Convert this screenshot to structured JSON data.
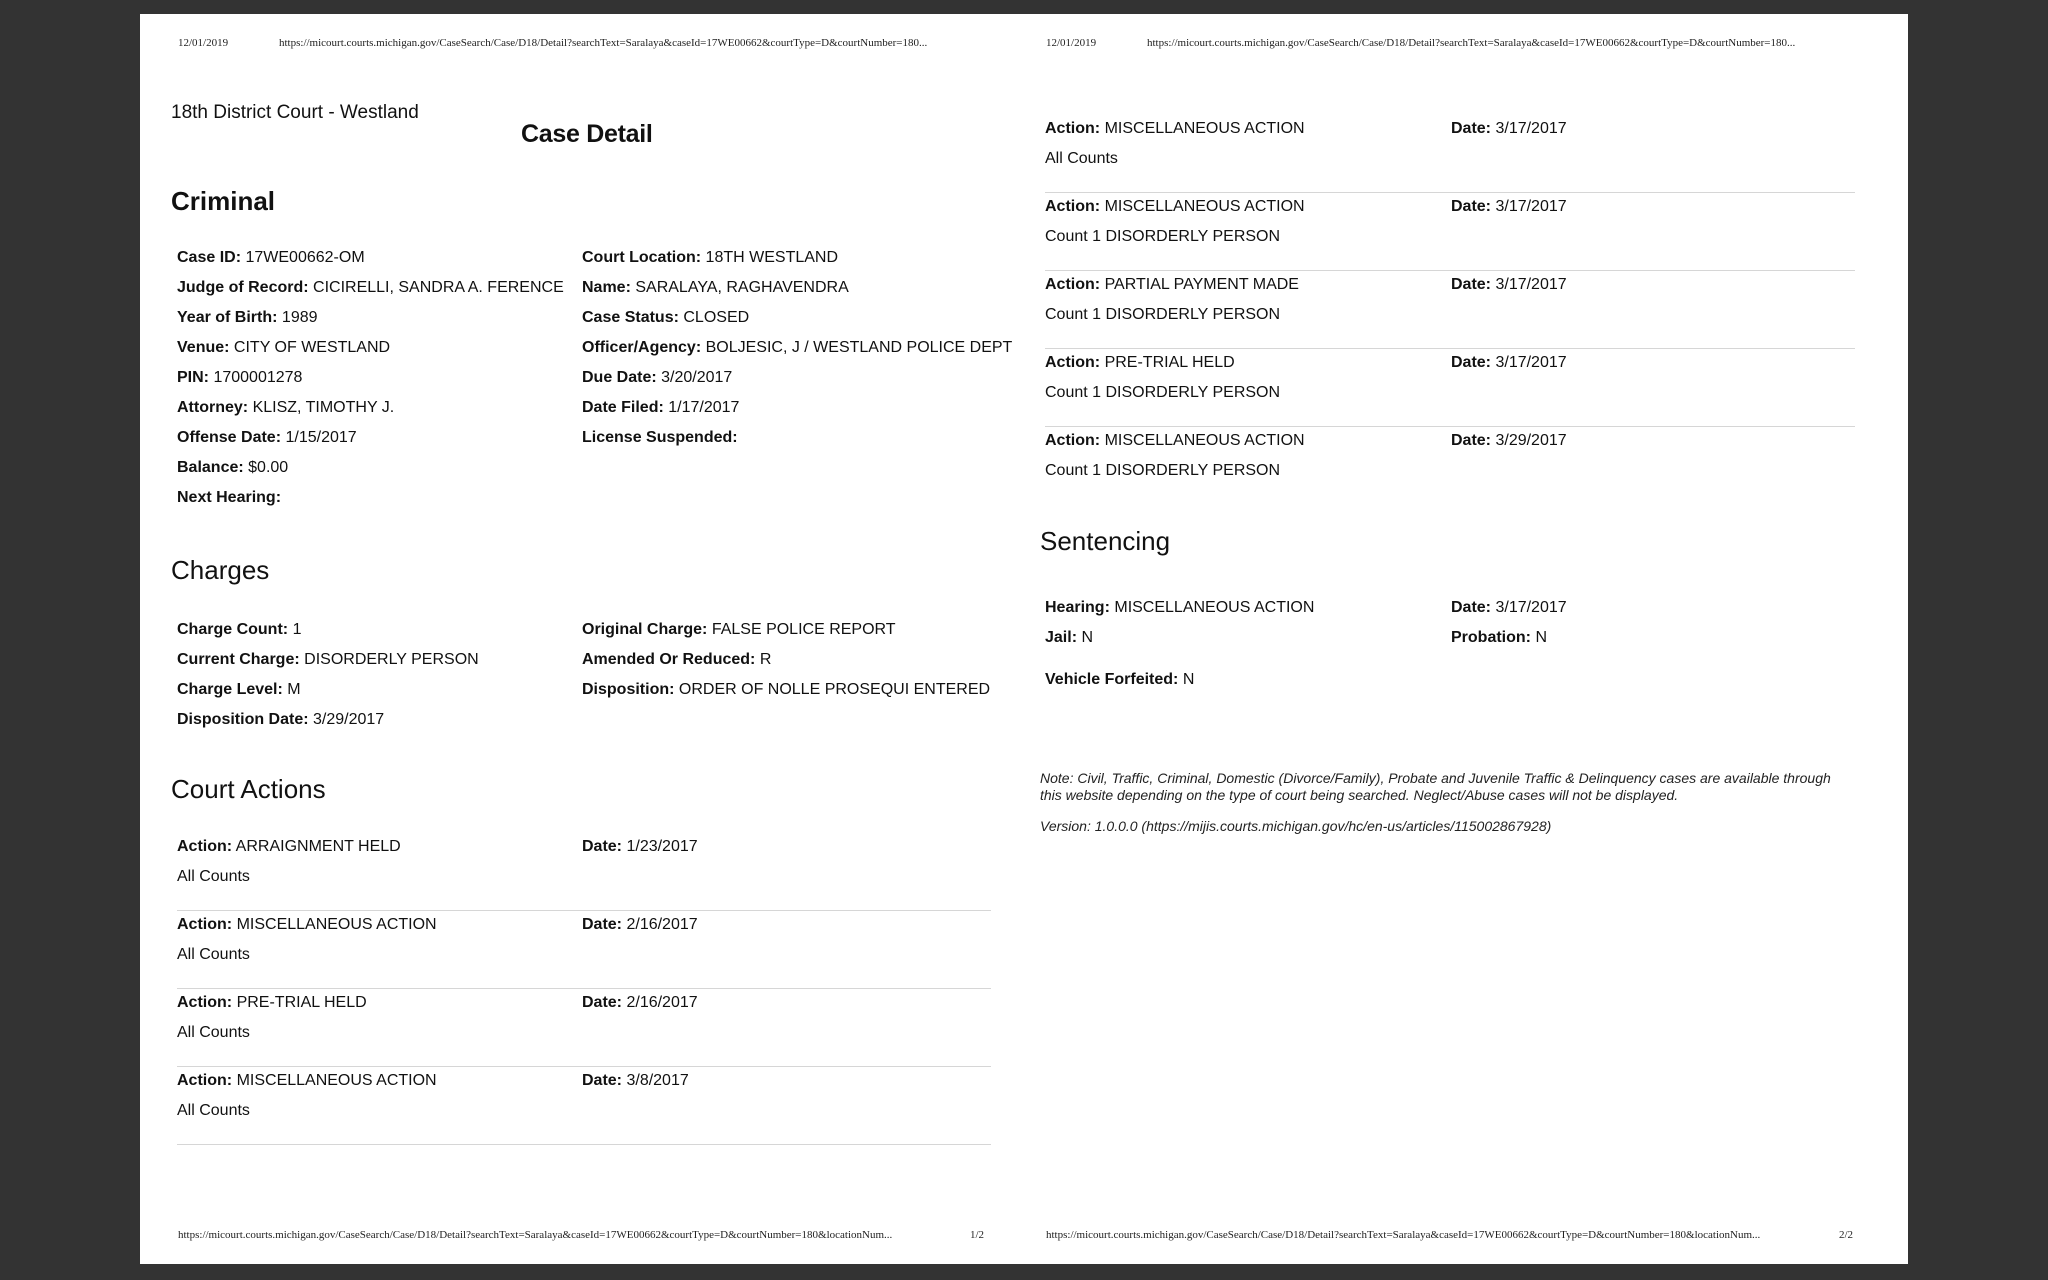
{
  "header": {
    "date": "12/01/2019",
    "url": "https://micourt.courts.michigan.gov/CaseSearch/Case/D18/Detail?searchText=Saralaya&caseId=17WE00662&courtType=D&courtNumber=180..."
  },
  "footer": {
    "url": "https://micourt.courts.michigan.gov/CaseSearch/Case/D18/Detail?searchText=Saralaya&caseId=17WE00662&courtType=D&courtNumber=180&locationNum...",
    "page1": "1/2",
    "page2": "2/2"
  },
  "court_name": "18th District Court - Westland",
  "title": "Case Detail",
  "criminal": {
    "heading": "Criminal",
    "left": [
      {
        "label": "Case ID:",
        "value": "17WE00662-OM"
      },
      {
        "label": "Judge of Record:",
        "value": "CICIRELLI, SANDRA A. FERENCE"
      },
      {
        "label": "Year of Birth:",
        "value": "1989"
      },
      {
        "label": "Venue:",
        "value": "CITY OF WESTLAND"
      },
      {
        "label": "PIN:",
        "value": "1700001278"
      },
      {
        "label": "Attorney:",
        "value": "KLISZ, TIMOTHY J."
      },
      {
        "label": "Offense Date:",
        "value": "1/15/2017"
      },
      {
        "label": "Balance:",
        "value": "$0.00"
      },
      {
        "label": "Next Hearing:",
        "value": ""
      }
    ],
    "right": [
      {
        "label": "Court Location:",
        "value": "18TH WESTLAND"
      },
      {
        "label": "Name:",
        "value": "SARALAYA, RAGHAVENDRA"
      },
      {
        "label": "Case Status:",
        "value": "CLOSED"
      },
      {
        "label": "Officer/Agency:",
        "value": "BOLJESIC, J / WESTLAND POLICE DEPT"
      },
      {
        "label": "Due Date:",
        "value": "3/20/2017"
      },
      {
        "label": "Date Filed:",
        "value": "1/17/2017"
      },
      {
        "label": "License Suspended:",
        "value": ""
      }
    ]
  },
  "charges": {
    "heading": "Charges",
    "left": [
      {
        "label": "Charge Count:",
        "value": "1"
      },
      {
        "label": "Current Charge:",
        "value": "DISORDERLY PERSON"
      },
      {
        "label": "Charge Level:",
        "value": "M"
      },
      {
        "label": "Disposition Date:",
        "value": "3/29/2017"
      }
    ],
    "right": [
      {
        "label": "Original Charge:",
        "value": "FALSE POLICE REPORT"
      },
      {
        "label": "Amended Or Reduced:",
        "value": "R"
      },
      {
        "label": "Disposition:",
        "value": "ORDER OF NOLLE PROSEQUI ENTERED"
      }
    ]
  },
  "court_actions": {
    "heading": "Court Actions",
    "action_label": "Action:",
    "date_label": "Date:",
    "page1": [
      {
        "action": "ARRAIGNMENT HELD",
        "date": "1/23/2017",
        "sub": "All Counts"
      },
      {
        "action": "MISCELLANEOUS ACTION",
        "date": "2/16/2017",
        "sub": "All Counts"
      },
      {
        "action": "PRE-TRIAL HELD",
        "date": "2/16/2017",
        "sub": "All Counts"
      },
      {
        "action": "MISCELLANEOUS ACTION",
        "date": "3/8/2017",
        "sub": "All Counts"
      }
    ],
    "page2": [
      {
        "action": "MISCELLANEOUS ACTION",
        "date": "3/17/2017",
        "sub": "All Counts"
      },
      {
        "action": "MISCELLANEOUS ACTION",
        "date": "3/17/2017",
        "sub": "Count 1 DISORDERLY PERSON"
      },
      {
        "action": "PARTIAL PAYMENT MADE",
        "date": "3/17/2017",
        "sub": "Count 1 DISORDERLY PERSON"
      },
      {
        "action": "PRE-TRIAL HELD",
        "date": "3/17/2017",
        "sub": "Count 1 DISORDERLY PERSON"
      },
      {
        "action": "MISCELLANEOUS ACTION",
        "date": "3/29/2017",
        "sub": "Count 1 DISORDERLY PERSON"
      }
    ]
  },
  "sentencing": {
    "heading": "Sentencing",
    "hearing": {
      "label": "Hearing:",
      "value": "MISCELLANEOUS ACTION"
    },
    "date": {
      "label": "Date:",
      "value": "3/17/2017"
    },
    "jail": {
      "label": "Jail:",
      "value": "N"
    },
    "probation": {
      "label": "Probation:",
      "value": "N"
    },
    "vehicle": {
      "label": "Vehicle Forfeited:",
      "value": "N"
    }
  },
  "note": "Note: Civil, Traffic, Criminal, Domestic (Divorce/Family), Probate and Juvenile Traffic & Delinquency cases are available through this website depending on the type of court being searched. Neglect/Abuse cases will not be displayed.",
  "version": "Version: 1.0.0.0 (https://mijis.courts.michigan.gov/hc/en-us/articles/115002867928)"
}
